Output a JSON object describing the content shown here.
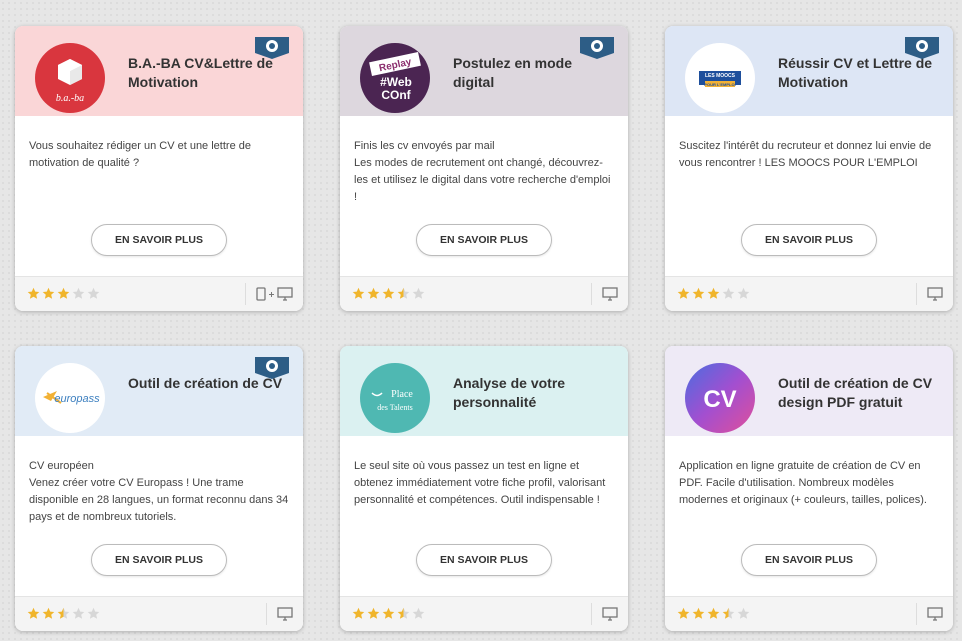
{
  "colors": {
    "badge": "#2d5d86",
    "star_on": "#f0b52c",
    "star_off": "#d7d7d7"
  },
  "cards": [
    {
      "title": "B.A.-BA CV&Lettre de Motivation",
      "header_color": "#fad6d7",
      "logo_text": "b.a.-ba",
      "description": "Vous souhaitez rédiger un CV et une lettre de motivation de qualité ?",
      "button": "EN SAVOIR PLUS",
      "rating": 3,
      "devices": [
        "mobile-icon",
        "plus-icon",
        "desktop-icon"
      ],
      "badge": true
    },
    {
      "title": "Postulez en mode digital",
      "header_color": "#ddd7de",
      "logo_text_1": "Replay",
      "logo_text_2": "#Web",
      "logo_text_3": "COnf",
      "description": "Finis les cv envoyés par mail\nLes modes de recrutement ont changé, découvrez-les et utilisez le digital dans votre recherche d'emploi !",
      "button": "EN SAVOIR PLUS",
      "rating": 3.5,
      "devices": [
        "desktop-icon"
      ],
      "badge": true
    },
    {
      "title": "Réussir CV et Lettre de Motivation",
      "header_color": "#dde6f5",
      "logo_text_1": "LES MOOCS",
      "logo_text_2": "POUR L'EMPLOI",
      "description": "Suscitez l'intérêt du recruteur et donnez lui envie de vous rencontrer ! LES MOOCS POUR L'EMPLOI",
      "button": "EN SAVOIR PLUS",
      "rating": 3,
      "devices": [
        "desktop-icon"
      ],
      "badge": true
    },
    {
      "title": "Outil de création de CV",
      "header_color": "#e1ebf6",
      "logo_text": "europass",
      "description": "CV européen\nVenez créer votre CV Europass ! Une trame disponible en 28 langues, un format reconnu dans 34 pays et de nombreux tutoriels.",
      "button": "EN SAVOIR PLUS",
      "rating": 2.5,
      "devices": [
        "desktop-icon"
      ],
      "badge": true
    },
    {
      "title": "Analyse de votre personnalité",
      "header_color": "#dbf1f1",
      "logo_text_1": "Place",
      "logo_text_2": "des Talents",
      "description": "Le seul site où vous passez un test en ligne et obtenez immédiatement votre fiche profil, valorisant personnalité et compétences. Outil indispensable !",
      "button": "EN SAVOIR PLUS",
      "rating": 3.5,
      "devices": [
        "desktop-icon"
      ],
      "badge": false
    },
    {
      "title": "Outil de création de CV design PDF gratuit",
      "header_color": "#eeeaf6",
      "logo_text": "CV",
      "description": "Application en ligne gratuite de création de CV en PDF. Facile d'utilisation. Nombreux modèles modernes et originaux (+ couleurs, tailles, polices).",
      "button": "EN SAVOIR PLUS",
      "rating": 3.5,
      "devices": [
        "desktop-icon"
      ],
      "badge": false
    }
  ]
}
